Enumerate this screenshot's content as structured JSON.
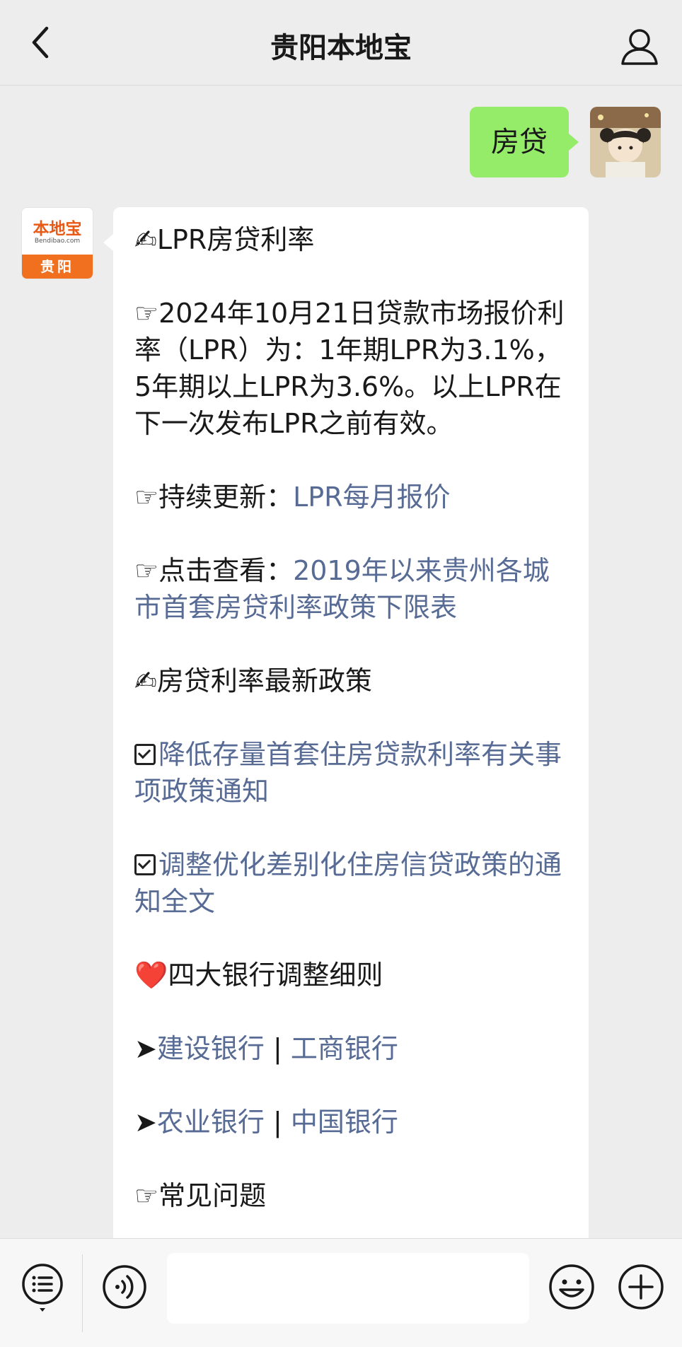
{
  "header": {
    "title": "贵阳本地宝",
    "back_icon": "chevron-left-icon",
    "profile_icon": "person-icon"
  },
  "user_message": {
    "text": "房贷"
  },
  "bot": {
    "logo_main": "本地宝",
    "logo_sub": "Bendibao.com",
    "logo_city": "贵阳"
  },
  "bot_message": {
    "section1_title": "✍LPR房贷利率",
    "lpr_text": "☞2024年10月21日贷款市场报价利率（LPR）为：1年期LPR为3.1%，5年期以上LPR为3.6%。以上LPR在下一次发布LPR之前有效。",
    "update_prefix": "☞持续更新：",
    "update_link": "LPR每月报价",
    "view_prefix": "☞点击查看：",
    "view_link": "2019年以来贵州各城市首套房贷利率政策下限表",
    "section2_title": "✍房贷利率最新政策",
    "policy_link1": "降低存量首套住房贷款利率有关事项政策通知",
    "policy_link2": "调整优化差别化住房信贷政策的通知全文",
    "section3_title": "❤️四大银行调整细则",
    "bank_arrow": "➤",
    "bank_separator": " | ",
    "bank_ccb": "建设银行",
    "bank_icbc": "工商银行",
    "bank_abc": "农业银行",
    "bank_boc": "中国银行",
    "faq_title": "☞常见问题"
  },
  "input_bar": {
    "placeholder": "",
    "menu_icon": "list-menu-icon",
    "voice_icon": "voice-icon",
    "emoji_icon": "smiley-icon",
    "plus_icon": "plus-icon"
  },
  "colors": {
    "background": "#ededed",
    "user_bubble": "#95ec69",
    "link": "#576b95",
    "logo_orange": "#f07020"
  }
}
